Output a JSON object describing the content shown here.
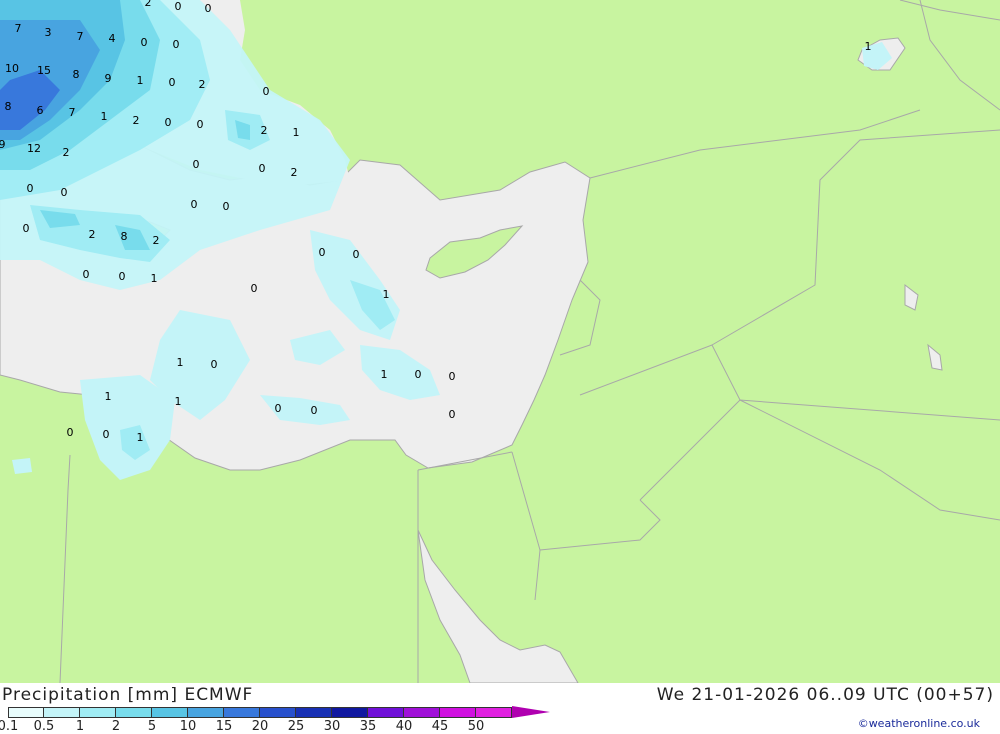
{
  "footer": {
    "title": "Precipitation [mm] ECMWF",
    "datetime": "We 21-01-2026 06..09 UTC (00+57)",
    "credit": "©weatheronline.co.uk"
  },
  "legend": {
    "ticks": [
      "0.1",
      "0.5",
      "1",
      "2",
      "5",
      "10",
      "15",
      "20",
      "25",
      "30",
      "35",
      "40",
      "45",
      "50"
    ],
    "colors": [
      "#e8fcfc",
      "#c4f4f8",
      "#a0ecf4",
      "#78dcec",
      "#58c4e4",
      "#48a4e0",
      "#3878dc",
      "#2850cc",
      "#1830b4",
      "#1018a0",
      "#7010d8",
      "#a010d8",
      "#d010e0",
      "#e020e0"
    ],
    "arrow_color": "#b000b0"
  },
  "map": {
    "land_color": "#c8f4a0",
    "sea_color": "#eeeeee",
    "border_color": "#a8a8a8",
    "labels": [
      {
        "t": "7"
      },
      {
        "t": "3"
      },
      {
        "t": "7"
      },
      {
        "t": "4"
      },
      {
        "t": "0"
      },
      {
        "t": "0"
      },
      {
        "t": "2"
      },
      {
        "t": "0"
      },
      {
        "t": "0"
      },
      {
        "t": "10"
      },
      {
        "t": "15"
      },
      {
        "t": "8"
      },
      {
        "t": "9"
      },
      {
        "t": "1"
      },
      {
        "t": "0"
      },
      {
        "t": "2"
      },
      {
        "t": "0"
      },
      {
        "t": "8"
      },
      {
        "t": "6"
      },
      {
        "t": "7"
      },
      {
        "t": "1"
      },
      {
        "t": "2"
      },
      {
        "t": "0"
      },
      {
        "t": "0"
      },
      {
        "t": "2"
      },
      {
        "t": "1"
      },
      {
        "t": "9"
      },
      {
        "t": "12"
      },
      {
        "t": "2"
      },
      {
        "t": "0"
      },
      {
        "t": "0"
      },
      {
        "t": "2"
      },
      {
        "t": "0"
      },
      {
        "t": "0"
      },
      {
        "t": "0"
      },
      {
        "t": "0"
      },
      {
        "t": "0"
      },
      {
        "t": "2"
      },
      {
        "t": "8"
      },
      {
        "t": "2"
      },
      {
        "t": "0"
      },
      {
        "t": "0"
      },
      {
        "t": "1"
      },
      {
        "t": "0"
      },
      {
        "t": "0"
      },
      {
        "t": "0"
      },
      {
        "t": "1"
      },
      {
        "t": "1"
      },
      {
        "t": "0"
      },
      {
        "t": "1"
      },
      {
        "t": "1"
      },
      {
        "t": "0"
      },
      {
        "t": "1"
      },
      {
        "t": "0"
      },
      {
        "t": "0"
      },
      {
        "t": "0"
      },
      {
        "t": "0"
      },
      {
        "t": "0"
      },
      {
        "t": "0"
      },
      {
        "t": "1"
      },
      {
        "t": "1"
      }
    ]
  }
}
